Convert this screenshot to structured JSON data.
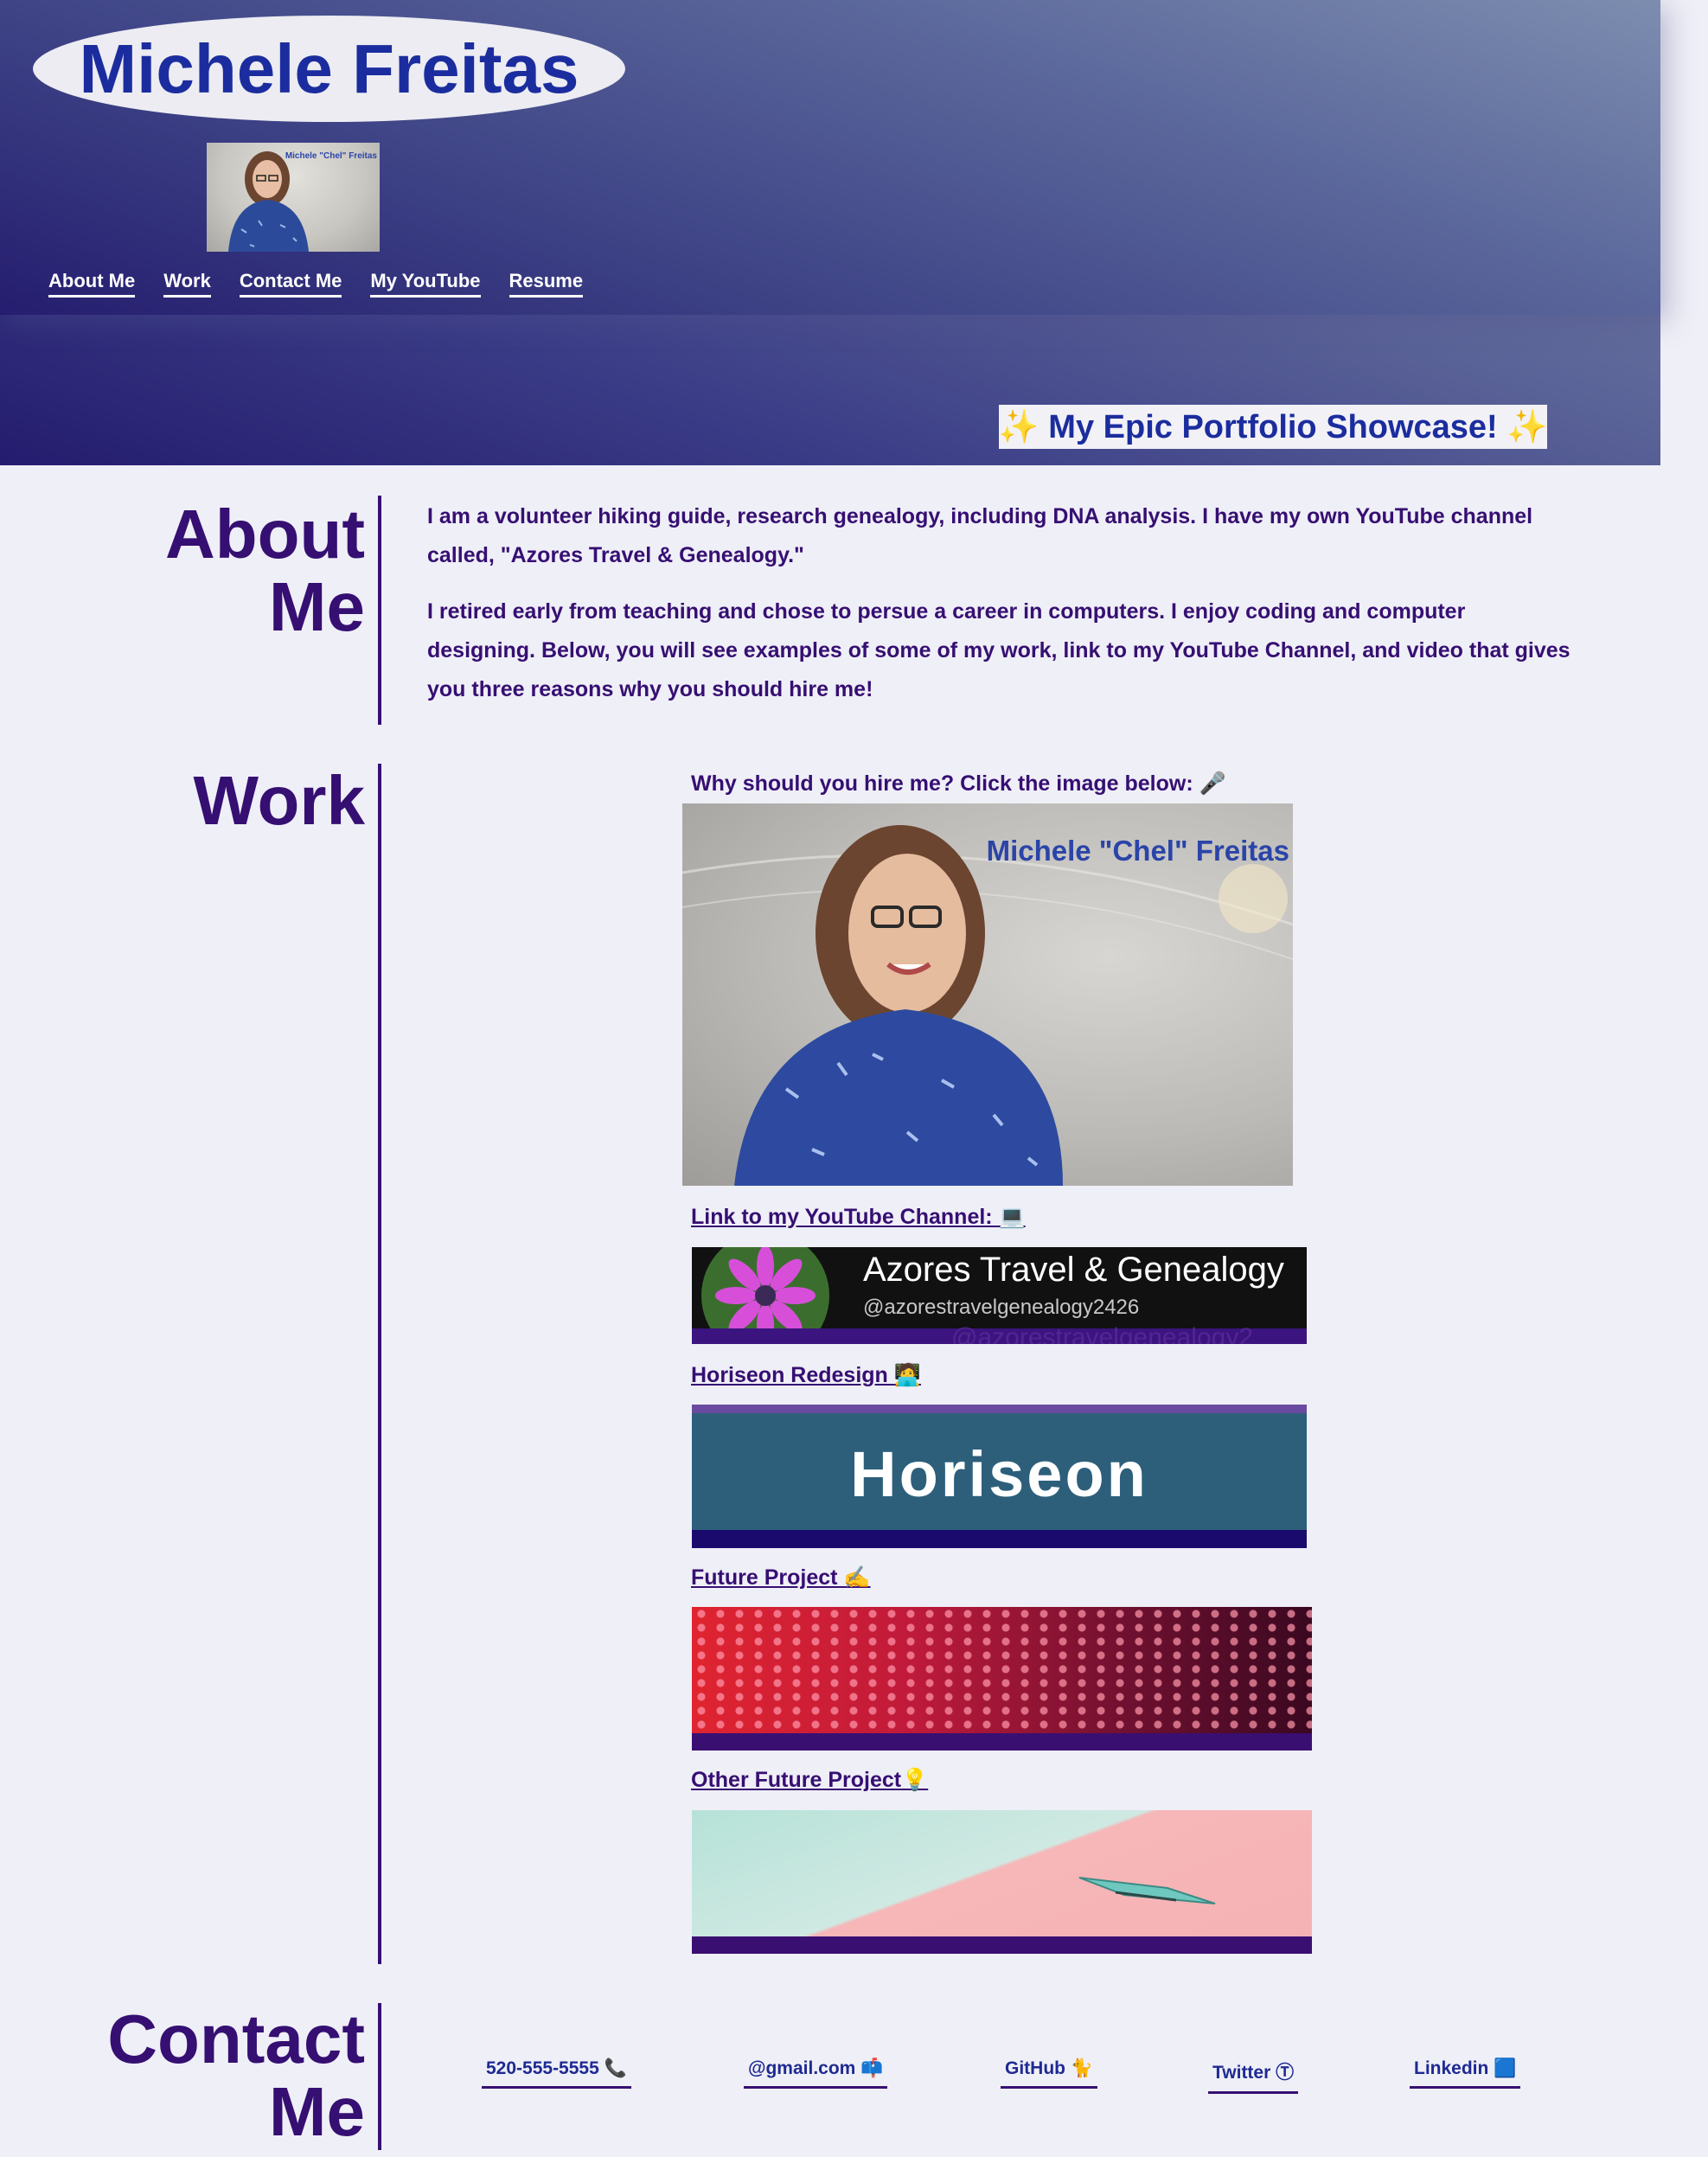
{
  "header": {
    "name": "Michele Freitas",
    "avatar_caption": "Michele \"Chel\" Freitas",
    "nav": [
      {
        "label": "About Me"
      },
      {
        "label": "Work"
      },
      {
        "label": "Contact Me"
      },
      {
        "label": "My YouTube"
      },
      {
        "label": "Resume"
      }
    ],
    "showcase": "✨ My Epic Portfolio Showcase! ✨"
  },
  "about": {
    "title_line1": "About",
    "title_line2": "Me",
    "paragraph1": "I am a volunteer hiking guide, research genealogy, including DNA analysis. I have my own YouTube channel called, \"Azores Travel & Genealogy.\"",
    "paragraph2": "I retired early from teaching and chose to persue a career in computers. I enjoy coding and computer designing. Below, you will see examples of some of my work, link to my YouTube Channel, and video that gives you three reasons why you should hire me!"
  },
  "work": {
    "title": "Work",
    "hire_prompt": "Why should you hire me? Click the image below: 🎤",
    "video_caption": "Michele \"Chel\" Freitas",
    "youtube_link": "Link to my YouTube Channel: 💻",
    "youtube_banner_title": "Azores Travel & Genealogy",
    "youtube_banner_handle": "@azorestravelgenealogy2426",
    "youtube_banner_watermark": "@azorestravelgenealogy2",
    "horiseon_link": "Horiseon Redesign 🧑‍💻",
    "horiseon_banner": "Horiseon",
    "future_link": "Future Project ✍️",
    "other_future_link": "Other Future Project💡"
  },
  "contact": {
    "title_line1": "Contact",
    "title_line2": "Me",
    "links": [
      {
        "label": "520-555-5555 📞"
      },
      {
        "label": "@gmail.com 📫"
      },
      {
        "label": "GitHub 🐈"
      },
      {
        "label": "Twitter Ⓣ"
      },
      {
        "label": "Linkedin 🟦"
      }
    ]
  },
  "colors": {
    "accent": "#360f72",
    "brand_blue": "#1b2d9e",
    "page_bg": "#efeff7"
  }
}
